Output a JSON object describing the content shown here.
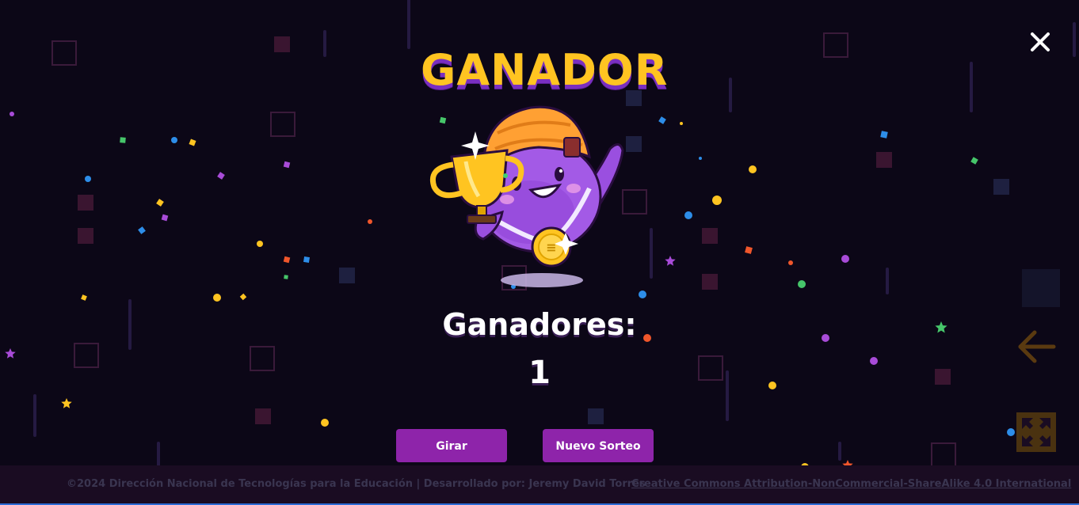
{
  "modal": {
    "title": "GANADOR",
    "winners_label": "Ganadores:",
    "winners_count": "1"
  },
  "buttons": {
    "spin": "Girar",
    "new_draw": "Nuevo Sorteo"
  },
  "icons": {
    "close": "close-icon",
    "back": "arrow-left-icon",
    "fullscreen": "fullscreen-icon",
    "mascot": "mascot-trophy-illustration"
  },
  "footer": {
    "credits": "©2024 Dirección Nacional de Tecnologías para la Educación | Desarrollado por: Jeremy David Torres",
    "license_link": "Creative Commons Attribution-NonCommercial-ShareAlike 4.0 International"
  },
  "colors": {
    "background": "#0c0717",
    "title": "#ffc421",
    "title_shadow": "#7a2fc0",
    "button": "#8e24aa",
    "side_icons": "#5a3a10"
  }
}
